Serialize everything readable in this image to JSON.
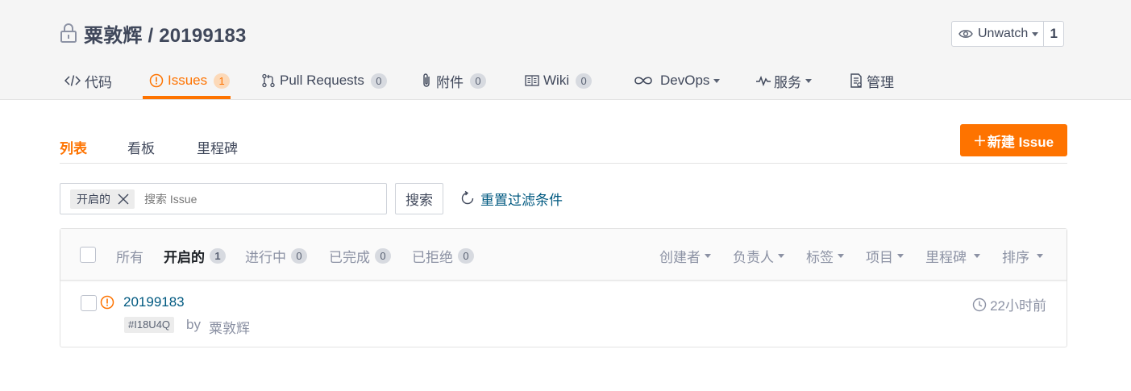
{
  "repo": {
    "title": "粟敦辉 / 20199183",
    "watch_label": "Unwatch",
    "watch_count": "1"
  },
  "nav": {
    "items": [
      {
        "label": "代码",
        "icon": "code-icon"
      },
      {
        "label": "Issues",
        "icon": "issue-icon",
        "count": "1"
      },
      {
        "label": "Pull Requests",
        "icon": "pull-request-icon",
        "count": "0"
      },
      {
        "label": "附件",
        "icon": "attachment-icon",
        "count": "0"
      },
      {
        "label": "Wiki",
        "icon": "wiki-icon",
        "count": "0"
      },
      {
        "label": "DevOps",
        "icon": "devops-icon"
      },
      {
        "label": "服务",
        "icon": "service-icon"
      },
      {
        "label": "管理",
        "icon": "manage-icon"
      }
    ],
    "active": "Issues"
  },
  "subtabs": [
    "列表",
    "看板",
    "里程碑"
  ],
  "new_issue_label": "新建 Issue",
  "filter": {
    "chip_label": "开启的",
    "placeholder": "搜索 Issue",
    "search_label": "搜索",
    "reset_label": "重置过滤条件"
  },
  "list": {
    "states": [
      {
        "label": "所有"
      },
      {
        "label": "开启的",
        "count": "1"
      },
      {
        "label": "进行中",
        "count": "0"
      },
      {
        "label": "已完成",
        "count": "0"
      },
      {
        "label": "已拒绝",
        "count": "0"
      }
    ],
    "filters": [
      "创建者",
      "负责人",
      "标签",
      "项目",
      "里程碑",
      "排序"
    ],
    "issues": [
      {
        "title": "20199183",
        "id": "#I18U4Q",
        "by": "by",
        "author": "粟敦辉",
        "time": "22小时前"
      }
    ]
  },
  "colors": {
    "accent": "#fe7300",
    "link": "#005980",
    "text": "#40485b",
    "muted": "#8c92a4"
  }
}
